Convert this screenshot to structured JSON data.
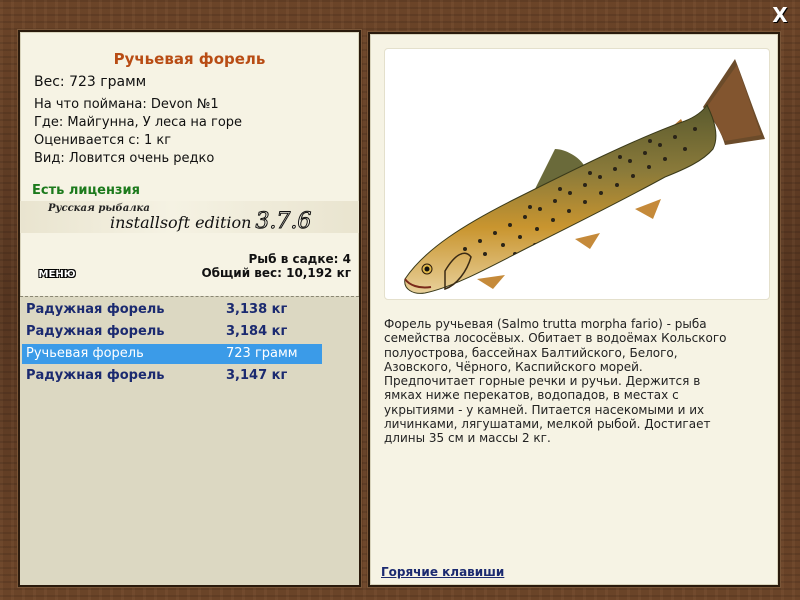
{
  "close_label": "X",
  "fish": {
    "title": "Ручьевая форель",
    "weight_line": "Вес: 723 грамм",
    "info": [
      "На что поймана: Devon №1",
      "Где: Майгунна, У леса на горе",
      "Оценивается с: 1 кг",
      "Вид: Ловится очень редко"
    ],
    "license": "Есть лицензия"
  },
  "brand": {
    "small": "Русская рыбалка",
    "big": "installsoft edition",
    "version": "3.7.6"
  },
  "menu_label": "МЕНЮ",
  "keepnet": {
    "count_line": "Рыб в садке: 4",
    "total_line": "Общий вес: 10,192 кг"
  },
  "catch_list": [
    {
      "name": "Радужная форель",
      "weight": "3,138 кг",
      "selected": false
    },
    {
      "name": "Радужная форель",
      "weight": "3,184 кг",
      "selected": false
    },
    {
      "name": "Ручьевая форель",
      "weight": "723 грамм",
      "selected": true
    },
    {
      "name": "Радужная форель",
      "weight": "3,147 кг",
      "selected": false
    }
  ],
  "description": [
    "Форель ручьевая (Salmo trutta morpha fario) - рыба",
    "семейства лососёвых. Обитает в водоёмах Кольского",
    "полуострова, бассейнах Балтийского, Белого,",
    "Азовского, Чёрного, Каспийского морей.",
    "Предпочитает горные речки и ручьи. Держится в",
    "ямках ниже перекатов, водопадов, в местах с",
    "укрытиями - у камней. Питается насекомыми и их",
    "личинками, лягушатами, мелкой рыбой. Достигает",
    "длины 35 см и массы 2 кг."
  ],
  "hotkeys_label": "Горячие клавиши",
  "colors": {
    "title": "#b84c14",
    "license": "#1c7a1c",
    "list_text": "#1b2a70",
    "selected_row": "#3b9be8"
  }
}
